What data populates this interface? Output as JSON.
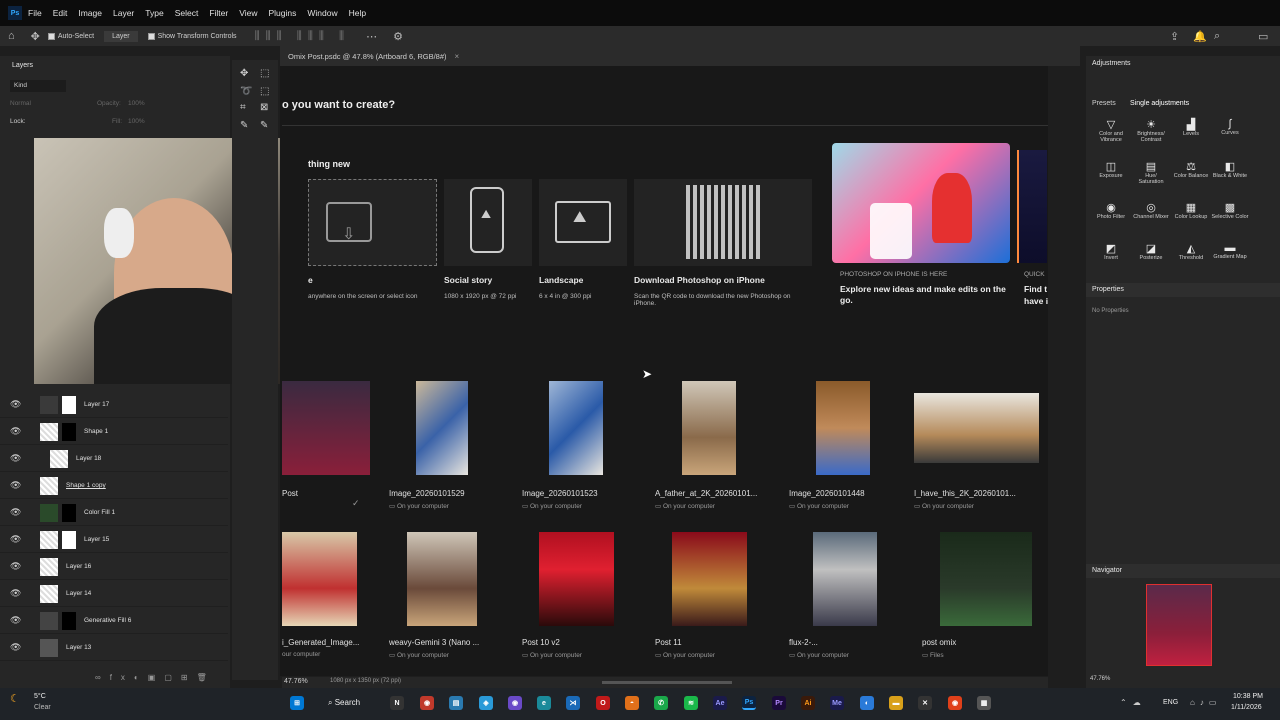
{
  "menubar": {
    "app_icon": "Ps",
    "items": [
      "File",
      "Edit",
      "Image",
      "Layer",
      "Type",
      "Select",
      "Filter",
      "View",
      "Plugins",
      "Window",
      "Help"
    ]
  },
  "options_bar": {
    "auto_select_label": "Auto-Select",
    "layer_dropdown": "Layer",
    "show_transform_label": "Show Transform Controls"
  },
  "document_tab": {
    "title": "Omix Post.psdc @ 47.8% (Artboard 6, RGB/8#)"
  },
  "layers_panel": {
    "title": "Layers",
    "filter_kind": "Kind",
    "blend_mode": "Normal",
    "opacity_label": "Opacity:",
    "opacity_value": "100%",
    "lock_label": "Lock:",
    "fill_label": "Fill:",
    "fill_value": "100%",
    "layers": [
      "Layer 17",
      "Shape 1",
      "Layer 18",
      "Shape 1 copy",
      "Color Fill 1",
      "Layer 15",
      "Layer 16",
      "Layer 14",
      "Generative Fill 6",
      "Layer 13"
    ]
  },
  "home_screen": {
    "heading": "o you want to create?",
    "section_new": "thing new",
    "cards": [
      {
        "label": "e",
        "sub": "anywhere on the screen or select icon"
      },
      {
        "label": "Social story",
        "sub": "1080 x 1920 px @ 72 ppi"
      },
      {
        "label": "Landscape",
        "sub": "6 x 4 in @ 300 ppi"
      },
      {
        "label": "Download Photoshop on iPhone",
        "sub": "Scan the QR code to download the new Photoshop on iPhone."
      }
    ],
    "promo": {
      "eyebrow": "PHOTOSHOP ON IPHONE IS HERE",
      "text": "Explore new ideas and make edits on the go."
    },
    "promo2": {
      "eyebrow": "QUICK",
      "text1": "Find t",
      "text2": "have i"
    }
  },
  "recent_files_row1": [
    {
      "name": "Post",
      "loc": ""
    },
    {
      "name": "Image_20260101529",
      "loc": "On your computer"
    },
    {
      "name": "Image_20260101523",
      "loc": "On your computer"
    },
    {
      "name": "A_father_at_2K_20260101...",
      "loc": "On your computer"
    },
    {
      "name": "Image_20260101448",
      "loc": "On your computer"
    },
    {
      "name": "I_have_this_2K_20260101...",
      "loc": "On your computer"
    }
  ],
  "recent_files_row2": [
    {
      "name": "i_Generated_Image...",
      "loc": "our computer"
    },
    {
      "name": "weavy-Gemini 3 (Nano ...",
      "loc": "On your computer"
    },
    {
      "name": "Post 10 v2",
      "loc": "On your computer"
    },
    {
      "name": "Post 11",
      "loc": "On your computer"
    },
    {
      "name": "flux-2-...",
      "loc": "On your computer"
    },
    {
      "name": "post omix",
      "loc": "Files"
    }
  ],
  "status_bar": {
    "zoom": "47.76%",
    "doc_size": "1080 px x 1350 px (72 ppi)"
  },
  "adjustments_panel": {
    "title": "Adjustments",
    "tab_presets": "Presets",
    "tab_single": "Single adjustments",
    "items": [
      "Color and Vibrance",
      "Brightness/ Contrast",
      "Levels",
      "Curves",
      "Exposure",
      "Hue/ Saturation",
      "Color Balance",
      "Black & White",
      "Photo Filter",
      "Channel Mixer",
      "Color Lookup",
      "Selective Color",
      "Invert",
      "Posterize",
      "Threshold",
      "Gradient Map"
    ]
  },
  "properties_panel": {
    "title": "Properties",
    "empty": "No Properties"
  },
  "navigator_panel": {
    "title": "Navigator",
    "zoom": "47.76%"
  },
  "taskbar": {
    "weather_temp": "5°C",
    "weather_desc": "Clear",
    "search_label": "Search",
    "lang": "ENG",
    "time": "10:38 PM",
    "date": "1/11/2026"
  },
  "colors": {
    "accent": "#31a8ff",
    "bg_dark": "#181818",
    "panel": "#262626"
  }
}
